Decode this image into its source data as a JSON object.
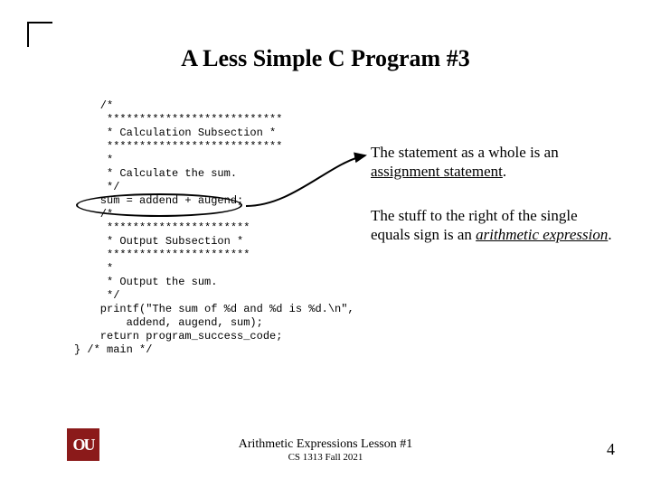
{
  "title": "A Less Simple C Program #3",
  "code": {
    "l01": "    /*",
    "l02": "     ***************************",
    "l03": "     * Calculation Subsection *",
    "l04": "     ***************************",
    "l05": "     *",
    "l06": "     * Calculate the sum.",
    "l07": "     */",
    "l08": "    sum = addend + augend;",
    "l09": "    /*",
    "l10": "     **********************",
    "l11": "     * Output Subsection *",
    "l12": "     **********************",
    "l13": "     *",
    "l14": "     * Output the sum.",
    "l15": "     */",
    "l16": "    printf(\"The sum of %d and %d is %d.\\n\",",
    "l17": "        addend, augend, sum);",
    "l18": "    return program_success_code;",
    "l19": "} /* main */"
  },
  "annot1": {
    "pre": "The statement as a whole is an ",
    "term": "assignment statement",
    "post": "."
  },
  "annot2": {
    "pre": "The stuff to the right of the single equals sign is an ",
    "term": "arithmetic expression",
    "post": "."
  },
  "logo": "OU",
  "footer": {
    "line1": "Arithmetic Expressions Lesson #1",
    "line2": "CS 1313 Fall 2021"
  },
  "pagenum": "4"
}
